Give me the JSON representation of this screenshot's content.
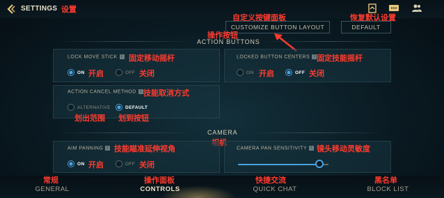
{
  "header": {
    "title": "SETTINGS",
    "title_annotation": "设置",
    "icons": [
      "back-arrow-icon",
      "bundle-icon",
      "chat-icon",
      "friends-icon"
    ]
  },
  "top_buttons": {
    "customize": {
      "label": "CUSTOMIZE BUTTON LAYOUT",
      "annotation": "自定义按键面板"
    },
    "default": {
      "label": "DEFAULT",
      "annotation": "恢复默认设置"
    }
  },
  "sections": {
    "action_buttons": {
      "title": "ACTION BUTTONS",
      "annotation": "操作按钮"
    },
    "camera": {
      "title": "CAMERA",
      "annotation": "相机"
    }
  },
  "settings": {
    "lock_move_stick": {
      "label": "LOCK MOVE STICK",
      "annotation": "固定移动摇杆",
      "options": [
        {
          "label": "ON",
          "annotation": "开启",
          "selected": true
        },
        {
          "label": "OFF",
          "annotation": "关闭",
          "selected": false
        }
      ]
    },
    "locked_button_centers": {
      "label": "LOCKED BUTTON CENTERS",
      "annotation": "固定技能摇杆",
      "options": [
        {
          "label": "ON",
          "annotation": "开启",
          "selected": false
        },
        {
          "label": "OFF",
          "annotation": "关闭",
          "selected": true
        }
      ]
    },
    "action_cancel_method": {
      "label": "ACTION CANCEL METHOD",
      "annotation": "技能取消方式",
      "options": [
        {
          "label": "ALTERNATIVE",
          "annotation": "划出范围",
          "selected": false
        },
        {
          "label": "DEFAULT",
          "annotation": "划到按钮",
          "selected": true
        }
      ]
    },
    "aim_panning": {
      "label": "AIM PANNING",
      "annotation": "技能瞄准延伸视角",
      "options": [
        {
          "label": "ON",
          "annotation": "开启",
          "selected": true
        },
        {
          "label": "OFF",
          "annotation": "关闭",
          "selected": false
        }
      ]
    },
    "camera_pan_sensitivity": {
      "label": "CAMERA PAN SENSITIVITY",
      "annotation": "镜头移动灵敏度",
      "value_fraction": 0.9
    }
  },
  "tabs": [
    {
      "label": "GENERAL",
      "annotation": "常规",
      "active": false
    },
    {
      "label": "CONTROLS",
      "annotation": "操作面板",
      "active": true
    },
    {
      "label": "QUICK CHAT",
      "annotation": "快捷交流",
      "active": false
    },
    {
      "label": "BLOCK LIST",
      "annotation": "黑名单",
      "active": false
    }
  ],
  "colors": {
    "accent": "#4aa3e0",
    "annotation": "#ff3b2f",
    "gold": "#e6c77a"
  }
}
